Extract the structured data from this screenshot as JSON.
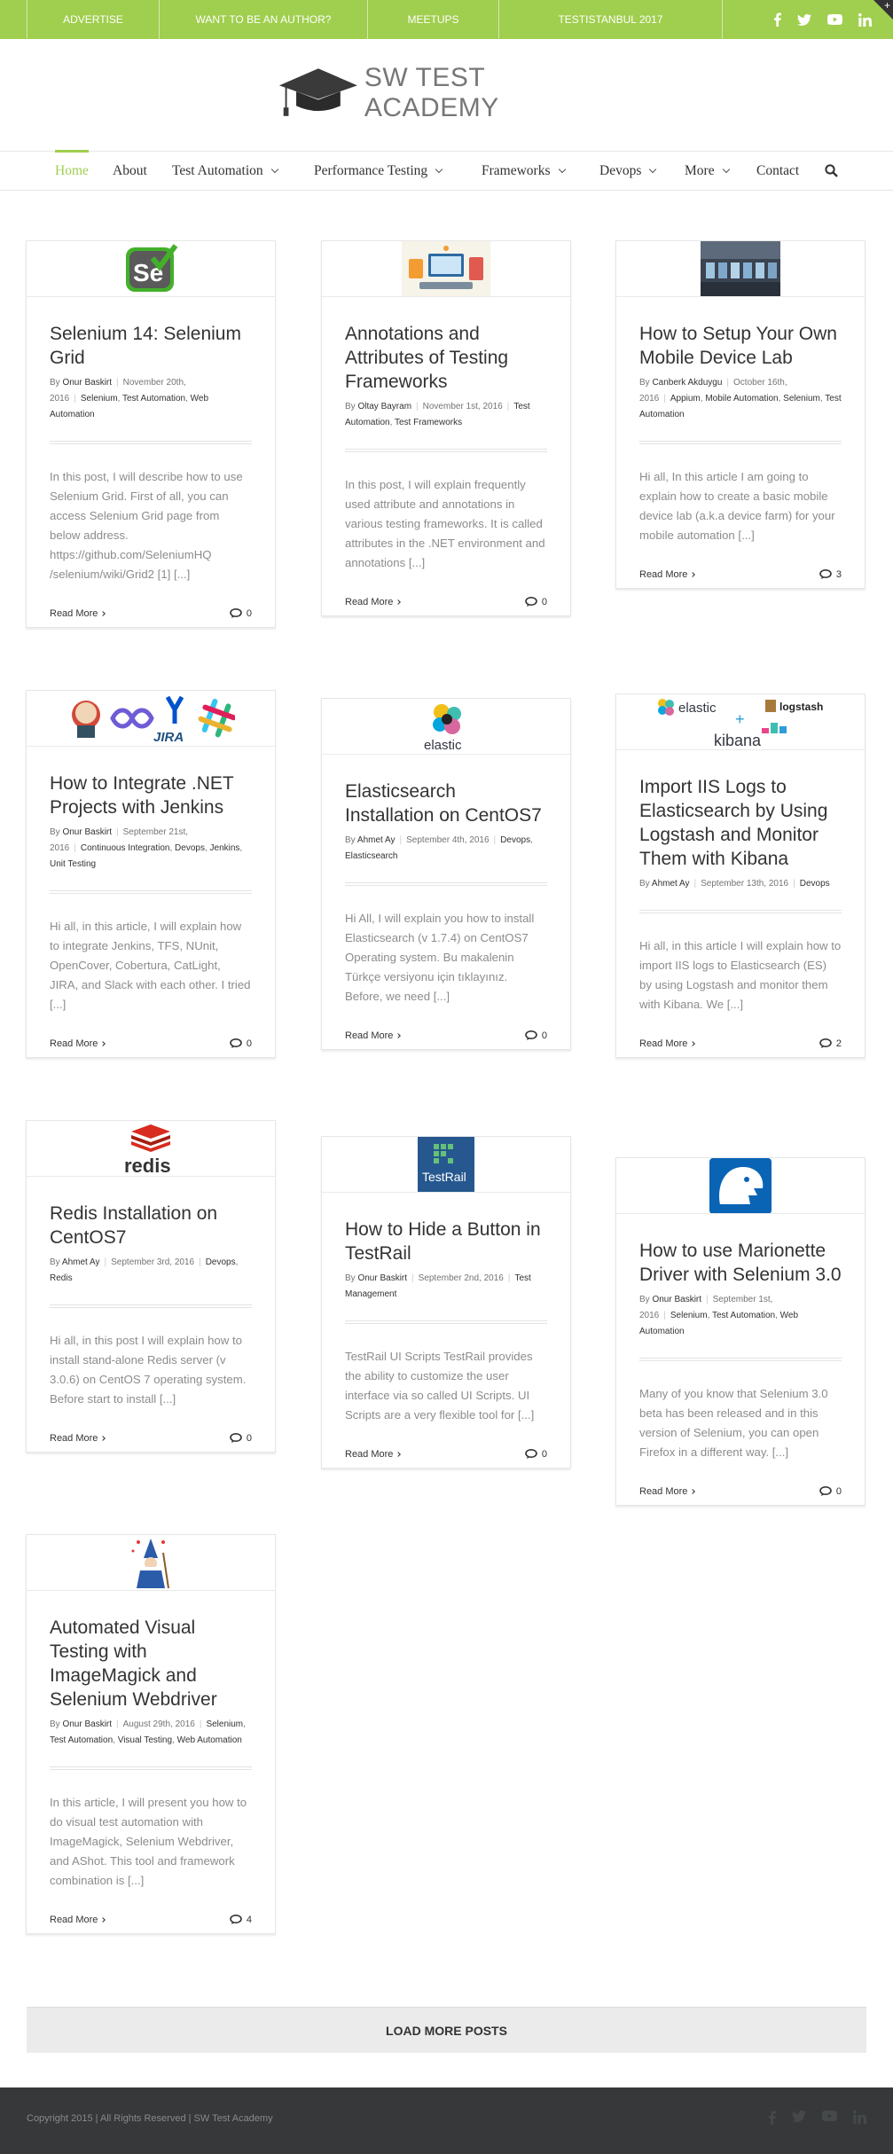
{
  "topbar": {
    "links": [
      "ADVERTISE",
      "WANT TO BE AN AUTHOR?",
      "MEETUPS",
      "TESTISTANBUL 2017"
    ],
    "social_icons": [
      "facebook-icon",
      "twitter-icon",
      "youtube-icon",
      "linkedin-icon"
    ],
    "corner_tab_glyph": "+"
  },
  "brand": {
    "name": "SW TEST ACADEMY",
    "accent_color": "#a0ce4e"
  },
  "nav": {
    "items": [
      {
        "label": "Home",
        "active": true,
        "has_dropdown": false
      },
      {
        "label": "About",
        "active": false,
        "has_dropdown": false
      },
      {
        "label": "Test Automation",
        "active": false,
        "has_dropdown": true
      },
      {
        "label": "Performance Testing",
        "active": false,
        "has_dropdown": true
      },
      {
        "label": "Frameworks",
        "active": false,
        "has_dropdown": true
      },
      {
        "label": "Devops",
        "active": false,
        "has_dropdown": true
      },
      {
        "label": "More",
        "active": false,
        "has_dropdown": true
      },
      {
        "label": "Contact",
        "active": false,
        "has_dropdown": false
      }
    ],
    "search_icon": "search-icon"
  },
  "posts": [
    {
      "image": "selenium-logo",
      "title": "Selenium 14: Selenium Grid",
      "by": "By",
      "author": "Onur Baskirt",
      "date": "November 20th, 2016",
      "categories": [
        "Selenium",
        "Test Automation",
        "Web Automation"
      ],
      "excerpt": "In this post, I will describe how to use Selenium Grid. First of all, you can access Selenium Grid page from below address. https://github.com/SeleniumHQ /selenium/wiki/Grid2 [1] [...]",
      "read_more": "Read More",
      "comments": "0"
    },
    {
      "image": "test-frameworks-illustration",
      "title": "Annotations and Attributes of Testing Frameworks",
      "by": "By",
      "author": "Oltay Bayram",
      "date": "November 1st, 2016",
      "categories": [
        "Test Automation",
        "Test Frameworks"
      ],
      "excerpt": "In this post, I will explain frequently used attribute and annotations in various testing frameworks. It is called attributes in the .NET environment and annotations [...]",
      "read_more": "Read More",
      "comments": "0"
    },
    {
      "image": "mobile-device-lab-photo",
      "title": "How to Setup Your Own Mobile Device Lab",
      "by": "By",
      "author": "Canberk Akduygu",
      "date": "October 16th, 2016",
      "categories": [
        "Appium",
        "Mobile Automation",
        "Selenium",
        "Test Automation"
      ],
      "excerpt": "Hi all, In this article I am going to explain how to create a basic mobile device lab (a.k.a device farm) for your mobile automation [...]",
      "read_more": "Read More",
      "comments": "3"
    },
    {
      "image": "jenkins-jira-slack-logos",
      "title": "How to Integrate .NET Projects with Jenkins",
      "by": "By",
      "author": "Onur Baskirt",
      "date": "September 21st, 2016",
      "categories": [
        "Continuous Integration",
        "Devops",
        "Jenkins",
        "Unit Testing"
      ],
      "excerpt": "Hi all, in this article, I will explain how to integrate Jenkins, TFS, NUnit, OpenCover, Cobertura, CatLight, JIRA, and Slack with each other. I tried [...]",
      "read_more": "Read More",
      "comments": "0"
    },
    {
      "image": "elastic-logo",
      "title": "Elasticsearch Installation on CentOS7",
      "by": "By",
      "author": "Ahmet Ay",
      "date": "September 4th, 2016",
      "categories": [
        "Devops",
        "Elasticsearch"
      ],
      "excerpt": "Hi All, I will explain you how to install Elasticsearch (v 1.7.4) on CentOS7 Operating system. Bu makalenin Türkçe versiyonu için tıklayınız. Before, we need [...]",
      "read_more": "Read More",
      "comments": "0"
    },
    {
      "image": "elk-stack-logos",
      "title": "Import IIS Logs to Elasticsearch by Using Logstash and Monitor Them with Kibana",
      "by": "By",
      "author": "Ahmet Ay",
      "date": "September 13th, 2016",
      "categories": [
        "Devops"
      ],
      "excerpt": "Hi all, in this article I will explain how to import IIS logs to Elasticsearch (ES) by using Logstash and monitor them with Kibana. We [...]",
      "read_more": "Read More",
      "comments": "2"
    },
    {
      "image": "redis-logo",
      "title": "Redis Installation on CentOS7",
      "by": "By",
      "author": "Ahmet Ay",
      "date": "September 3rd, 2016",
      "categories": [
        "Devops",
        "Redis"
      ],
      "excerpt": "Hi all, in this post I will explain how to install stand-alone Redis server (v 3.0.6) on CentOS 7 operating system. Before start to install [...]",
      "read_more": "Read More",
      "comments": "0"
    },
    {
      "image": "testrail-logo",
      "title": "How to Hide a Button in TestRail",
      "by": "By",
      "author": "Onur Baskirt",
      "date": "September 2nd, 2016",
      "categories": [
        "Test Management"
      ],
      "excerpt": "TestRail UI Scripts TestRail provides the ability to customize the user interface via so called UI Scripts. UI Scripts are a very flexible tool for [...]",
      "read_more": "Read More",
      "comments": "0"
    },
    {
      "image": "marionette-logo",
      "title": "How to use Marionette Driver with Selenium 3.0",
      "by": "By",
      "author": "Onur Baskirt",
      "date": "September 1st, 2016",
      "categories": [
        "Selenium",
        "Test Automation",
        "Web Automation"
      ],
      "excerpt": "Many of you know that Selenium 3.0 beta has been released and in this version of Selenium, you can open Firefox in a different way. [...]",
      "read_more": "Read More",
      "comments": "0"
    },
    {
      "image": "imagemagick-wizard-logo",
      "title": "Automated Visual Testing with ImageMagick and Selenium Webdriver",
      "by": "By",
      "author": "Onur Baskirt",
      "date": "August 29th, 2016",
      "categories": [
        "Selenium",
        "Test Automation",
        "Visual Testing",
        "Web Automation"
      ],
      "excerpt": "In this article, I will present you how to do visual test automation with ImageMagick, Selenium Webdriver, and AShot. This tool and framework combination is [...]",
      "read_more": "Read More",
      "comments": "4"
    }
  ],
  "load_more": "LOAD MORE POSTS",
  "footer": {
    "copyright": "Copyright 2015 | All Rights Reserved | SW Test Academy",
    "social_icons": [
      "facebook-icon",
      "twitter-icon",
      "youtube-icon",
      "linkedin-icon"
    ]
  }
}
